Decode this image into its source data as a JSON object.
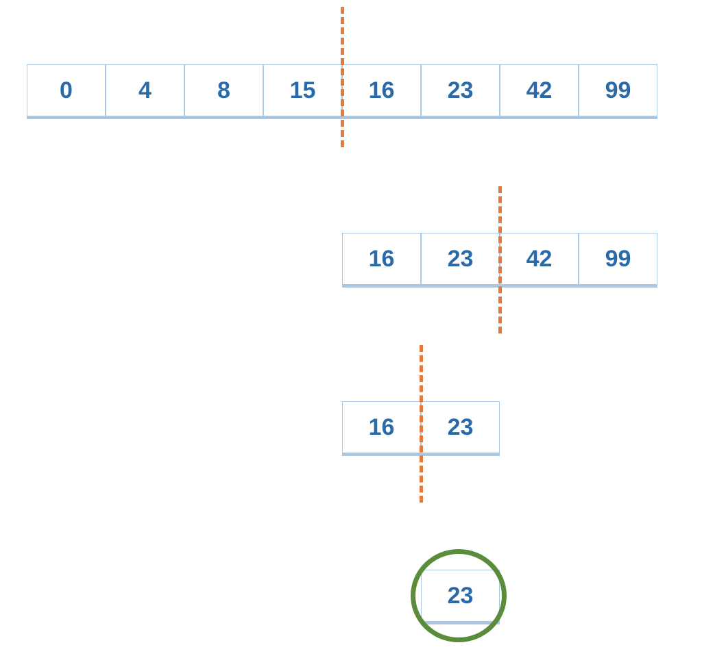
{
  "chart_data": {
    "type": "diagram",
    "description": "Binary search steps locating value 23 in a sorted array",
    "steps": [
      {
        "array": [
          0,
          4,
          8,
          15,
          16,
          23,
          42,
          99
        ],
        "split_after_index": 3
      },
      {
        "array": [
          16,
          23,
          42,
          99
        ],
        "split_after_index": 1
      },
      {
        "array": [
          16,
          23
        ],
        "split_after_index": 0
      },
      {
        "array": [
          23
        ],
        "found": true
      }
    ],
    "target": 23
  },
  "rows": {
    "r1": {
      "c0": "0",
      "c1": "4",
      "c2": "8",
      "c3": "15",
      "c4": "16",
      "c5": "23",
      "c6": "42",
      "c7": "99"
    },
    "r2": {
      "c0": "16",
      "c1": "23",
      "c2": "42",
      "c3": "99"
    },
    "r3": {
      "c0": "16",
      "c1": "23"
    },
    "r4": {
      "c0": "23"
    }
  }
}
